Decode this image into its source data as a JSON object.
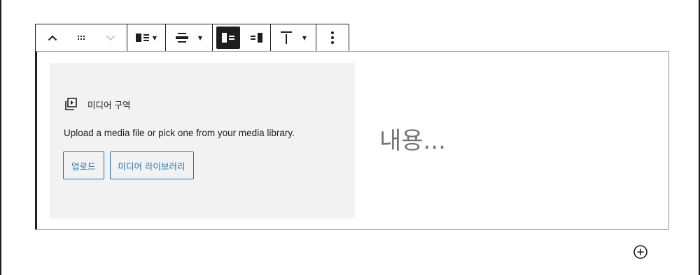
{
  "toolbar": {
    "buttons": [
      {
        "name": "move-up",
        "icon": "chevron-up-icon"
      },
      {
        "name": "drag-handle",
        "icon": "drag-handle-icon"
      },
      {
        "name": "move-down",
        "icon": "chevron-down-icon"
      },
      {
        "name": "block-alignment",
        "icon": "media-text-icon"
      },
      {
        "name": "align",
        "icon": "align-center-icon"
      },
      {
        "name": "media-left",
        "icon": "media-left-icon",
        "active": true
      },
      {
        "name": "media-right",
        "icon": "media-right-icon"
      },
      {
        "name": "vertical-align",
        "icon": "align-top-icon"
      },
      {
        "name": "more-options",
        "icon": "more-vertical-icon"
      }
    ]
  },
  "media_placeholder": {
    "title": "미디어 구역",
    "instructions": "Upload a media file or pick one from your media library.",
    "upload_label": "업로드",
    "library_label": "미디어 라이브러리"
  },
  "content": {
    "placeholder": "내용..."
  },
  "colors": {
    "accent": "#2271b1",
    "active_bg": "#1e1e1e",
    "placeholder_bg": "#f2f2f3",
    "placeholder_text": "#757575"
  }
}
